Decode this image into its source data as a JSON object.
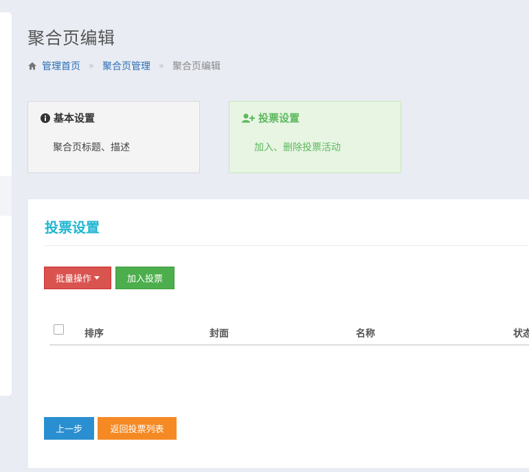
{
  "page": {
    "title": "聚合页编辑"
  },
  "breadcrumb": {
    "items": [
      "管理首页",
      "聚合页管理"
    ],
    "separator": "»",
    "current": "聚合页编辑"
  },
  "steps": [
    {
      "title": "基本设置",
      "description": "聚合页标题、描述",
      "icon": "info-circle-icon",
      "state": "inactive"
    },
    {
      "title": "投票设置",
      "description": "加入、删除投票活动",
      "icon": "user-plus-icon",
      "state": "active"
    }
  ],
  "panel": {
    "title": "投票设置",
    "toolbar": {
      "batch_label": "批量操作",
      "add_label": "加入投票"
    },
    "table": {
      "columns": [
        "排序",
        "封面",
        "名称",
        "状态"
      ],
      "rows": []
    },
    "footer": {
      "prev_label": "上一步",
      "back_label": "返回投票列表"
    }
  },
  "colors": {
    "accent": "#1fb5d1",
    "danger": "#d9534f",
    "success": "#4cae4c",
    "primary": "#2a8fd0",
    "warning": "#f58a24",
    "link": "#2c6db5"
  }
}
